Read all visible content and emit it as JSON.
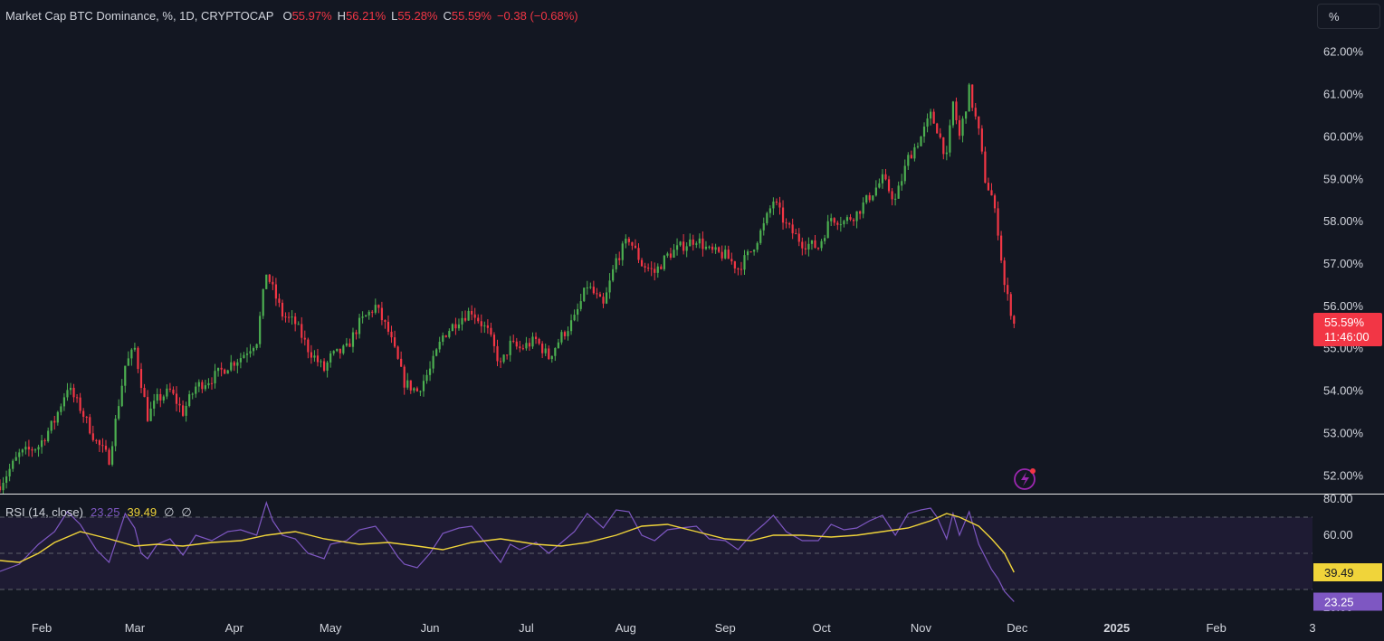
{
  "header": {
    "symbol": "Market Cap BTC Dominance, %, 1D, CRYPTOCAP",
    "open_label": "O",
    "open_value": "55.97%",
    "high_label": "H",
    "high_value": "56.21%",
    "low_label": "L",
    "low_value": "55.28%",
    "close_label": "C",
    "close_value": "55.59%",
    "change": "−0.38 (−0.68%)"
  },
  "unit_button": {
    "label": "%"
  },
  "price_tag": {
    "price": "55.59%",
    "countdown": "11:46:00"
  },
  "rsi_legend": {
    "name": "RSI (14, close)",
    "rsi_value": "23.25",
    "ma_value": "39.49",
    "na1": "∅",
    "na2": "∅"
  },
  "rsi_tags": {
    "ma": "39.49",
    "rsi": "23.25"
  },
  "colors": {
    "background": "#131722",
    "up": "#26a69a",
    "up_candle": "#4caf50",
    "down": "#f23645",
    "rsi_line": "#7e57c2",
    "rsi_ma": "#f0d43a",
    "rsi_band": "#1e1b33",
    "text": "#d1d4dc"
  },
  "chart_data": [
    {
      "type": "candlestick",
      "title": "Market Cap BTC Dominance, %, 1D, CRYPTOCAP",
      "ylim": [
        51.6,
        62.1
      ],
      "y_ticks": [
        "52.00%",
        "53.00%",
        "54.00%",
        "55.00%",
        "56.00%",
        "57.00%",
        "58.00%",
        "59.00%",
        "60.00%",
        "61.00%",
        "62.00%"
      ],
      "x_ticks": [
        "Feb",
        "Mar",
        "Apr",
        "May",
        "Jun",
        "Jul",
        "Aug",
        "Sep",
        "Oct",
        "Nov",
        "Dec",
        "2025",
        "Feb",
        "3"
      ],
      "x_range": [
        "2024-01-19",
        "2025-03-03"
      ],
      "close_series": {
        "dates": [
          "2024-01-19",
          "2024-01-25",
          "2024-01-31",
          "2024-02-05",
          "2024-02-09",
          "2024-02-13",
          "2024-02-18",
          "2024-02-22",
          "2024-02-27",
          "2024-03-01",
          "2024-03-03",
          "2024-03-05",
          "2024-03-08",
          "2024-03-12",
          "2024-03-16",
          "2024-03-20",
          "2024-03-25",
          "2024-03-30",
          "2024-04-03",
          "2024-04-08",
          "2024-04-11",
          "2024-04-13",
          "2024-04-16",
          "2024-04-20",
          "2024-04-24",
          "2024-04-29",
          "2024-05-01",
          "2024-05-06",
          "2024-05-10",
          "2024-05-15",
          "2024-05-19",
          "2024-05-22",
          "2024-05-24",
          "2024-05-28",
          "2024-06-01",
          "2024-06-05",
          "2024-06-10",
          "2024-06-14",
          "2024-06-19",
          "2024-06-23",
          "2024-06-26",
          "2024-06-29",
          "2024-07-04",
          "2024-07-08",
          "2024-07-12",
          "2024-07-16",
          "2024-07-20",
          "2024-07-25",
          "2024-07-29",
          "2024-08-02",
          "2024-08-06",
          "2024-08-10",
          "2024-08-14",
          "2024-08-18",
          "2024-08-23",
          "2024-08-27",
          "2024-09-01",
          "2024-09-05",
          "2024-09-09",
          "2024-09-13",
          "2024-09-16",
          "2024-09-20",
          "2024-09-25",
          "2024-09-30",
          "2024-10-04",
          "2024-10-08",
          "2024-10-12",
          "2024-10-16",
          "2024-10-20",
          "2024-10-24",
          "2024-10-28",
          "2024-11-01",
          "2024-11-04",
          "2024-11-06",
          "2024-11-09",
          "2024-11-11",
          "2024-11-13",
          "2024-11-16",
          "2024-11-19",
          "2024-11-21",
          "2024-11-23",
          "2024-11-25",
          "2024-11-27",
          "2024-11-30"
        ],
        "values": [
          51.8,
          52.5,
          52.7,
          53.3,
          54.1,
          53.6,
          52.8,
          52.4,
          54.6,
          55.0,
          54.2,
          53.4,
          53.8,
          54.0,
          53.5,
          54.1,
          54.3,
          54.6,
          54.8,
          55.2,
          56.8,
          56.4,
          55.8,
          55.6,
          55.0,
          54.5,
          54.8,
          55.0,
          55.6,
          56.0,
          55.4,
          54.7,
          54.2,
          54.0,
          54.5,
          55.3,
          55.7,
          55.9,
          55.4,
          54.6,
          55.1,
          55.0,
          55.2,
          54.8,
          55.3,
          55.7,
          56.5,
          56.0,
          57.1,
          57.6,
          57.0,
          56.8,
          57.2,
          57.4,
          57.6,
          57.3,
          57.2,
          56.9,
          57.3,
          57.9,
          58.5,
          57.9,
          57.5,
          57.4,
          58.1,
          58.0,
          58.2,
          58.6,
          59.0,
          58.5,
          59.5,
          60.0,
          60.5,
          60.2,
          59.5,
          60.8,
          60.0,
          61.1,
          60.1,
          59.0,
          58.6,
          57.8,
          56.5,
          55.6
        ],
        "last": 55.59
      },
      "last_ohlc": {
        "open": 55.97,
        "high": 56.21,
        "low": 55.28,
        "close": 55.59,
        "change": -0.38,
        "change_pct": -0.68
      }
    },
    {
      "type": "line",
      "title": "RSI (14, close)",
      "y_ticks": [
        "20.00",
        "40.00",
        "60.00",
        "80.00"
      ],
      "ylim": [
        20,
        80
      ],
      "levels": [
        30,
        50,
        70
      ],
      "series": [
        {
          "name": "RSI",
          "dates": [
            "2024-01-19",
            "2024-01-25",
            "2024-01-31",
            "2024-02-05",
            "2024-02-09",
            "2024-02-13",
            "2024-02-18",
            "2024-02-22",
            "2024-02-27",
            "2024-03-01",
            "2024-03-03",
            "2024-03-05",
            "2024-03-08",
            "2024-03-12",
            "2024-03-16",
            "2024-03-20",
            "2024-03-25",
            "2024-03-30",
            "2024-04-03",
            "2024-04-08",
            "2024-04-11",
            "2024-04-13",
            "2024-04-16",
            "2024-04-20",
            "2024-04-24",
            "2024-04-29",
            "2024-05-01",
            "2024-05-06",
            "2024-05-10",
            "2024-05-15",
            "2024-05-19",
            "2024-05-22",
            "2024-05-24",
            "2024-05-28",
            "2024-06-01",
            "2024-06-05",
            "2024-06-10",
            "2024-06-14",
            "2024-06-19",
            "2024-06-23",
            "2024-06-26",
            "2024-06-29",
            "2024-07-04",
            "2024-07-08",
            "2024-07-12",
            "2024-07-16",
            "2024-07-20",
            "2024-07-25",
            "2024-07-29",
            "2024-08-02",
            "2024-08-06",
            "2024-08-10",
            "2024-08-14",
            "2024-08-18",
            "2024-08-23",
            "2024-08-27",
            "2024-09-01",
            "2024-09-05",
            "2024-09-09",
            "2024-09-13",
            "2024-09-16",
            "2024-09-20",
            "2024-09-25",
            "2024-09-30",
            "2024-10-04",
            "2024-10-08",
            "2024-10-12",
            "2024-10-16",
            "2024-10-20",
            "2024-10-24",
            "2024-10-28",
            "2024-11-01",
            "2024-11-04",
            "2024-11-06",
            "2024-11-09",
            "2024-11-11",
            "2024-11-13",
            "2024-11-16",
            "2024-11-19",
            "2024-11-21",
            "2024-11-23",
            "2024-11-25",
            "2024-11-27",
            "2024-11-30"
          ],
          "values": [
            40,
            44,
            55,
            62,
            73,
            66,
            52,
            45,
            72,
            64,
            50,
            47,
            55,
            58,
            49,
            60,
            57,
            62,
            63,
            60,
            78,
            68,
            60,
            58,
            50,
            47,
            55,
            57,
            63,
            65,
            56,
            48,
            44,
            42,
            50,
            61,
            64,
            65,
            54,
            45,
            55,
            52,
            56,
            50,
            56,
            62,
            72,
            64,
            74,
            73,
            60,
            57,
            63,
            64,
            65,
            58,
            57,
            52,
            60,
            66,
            71,
            62,
            57,
            57,
            66,
            63,
            64,
            68,
            71,
            60,
            72,
            74,
            75,
            70,
            58,
            72,
            60,
            73,
            55,
            48,
            41,
            36,
            29,
            23.25
          ]
        },
        {
          "name": "RSI-based MA",
          "dates": [
            "2024-01-19",
            "2024-01-25",
            "2024-01-31",
            "2024-02-05",
            "2024-02-13",
            "2024-02-22",
            "2024-03-01",
            "2024-03-08",
            "2024-03-16",
            "2024-03-25",
            "2024-04-03",
            "2024-04-11",
            "2024-04-20",
            "2024-04-29",
            "2024-05-10",
            "2024-05-19",
            "2024-05-28",
            "2024-06-05",
            "2024-06-14",
            "2024-06-23",
            "2024-07-04",
            "2024-07-12",
            "2024-07-20",
            "2024-07-29",
            "2024-08-06",
            "2024-08-14",
            "2024-08-23",
            "2024-09-01",
            "2024-09-09",
            "2024-09-16",
            "2024-09-25",
            "2024-10-04",
            "2024-10-12",
            "2024-10-20",
            "2024-10-28",
            "2024-11-04",
            "2024-11-09",
            "2024-11-13",
            "2024-11-19",
            "2024-11-23",
            "2024-11-27",
            "2024-11-30"
          ],
          "values": [
            46,
            45,
            50,
            56,
            62,
            58,
            54,
            55,
            54,
            56,
            57,
            60,
            62,
            58,
            55,
            56,
            54,
            52,
            56,
            58,
            55,
            54,
            56,
            60,
            65,
            66,
            62,
            58,
            57,
            60,
            60,
            59,
            60,
            62,
            64,
            68,
            72,
            70,
            65,
            58,
            50,
            39.49
          ]
        }
      ]
    }
  ]
}
